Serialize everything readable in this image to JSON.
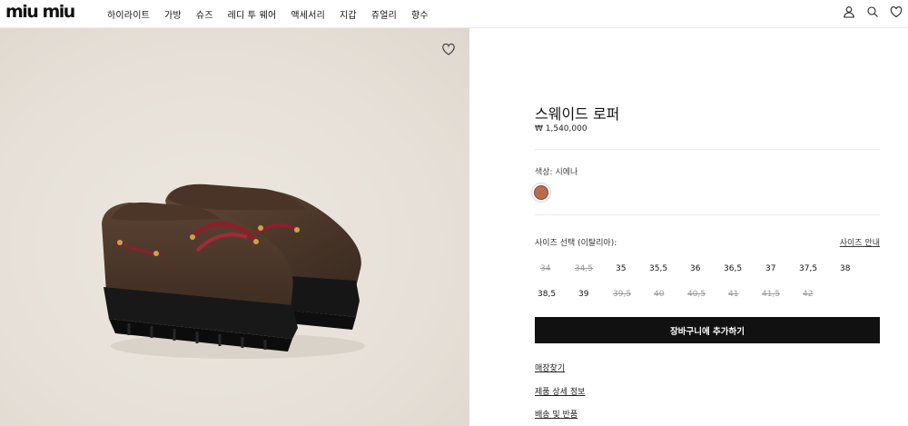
{
  "brand": {
    "logo_text": "miu miu"
  },
  "nav": {
    "items": [
      "하이라이트",
      "가방",
      "슈즈",
      "레디 투 웨어",
      "액세서리",
      "지갑",
      "쥬얼리",
      "향수"
    ]
  },
  "header_icons": [
    "user-icon",
    "search-icon",
    "heart-icon"
  ],
  "product": {
    "title": "스웨이드 로퍼",
    "price": "₩ 1,540,000",
    "color_label": "색상:  시에나",
    "color_swatch": "#bd6a4c",
    "size_label": "사이즈 선택 (이탈리아):",
    "size_guide": "사이즈 안내",
    "sizes": [
      {
        "label": "34",
        "available": false
      },
      {
        "label": "34,5",
        "available": false
      },
      {
        "label": "35",
        "available": true
      },
      {
        "label": "35,5",
        "available": true
      },
      {
        "label": "36",
        "available": true
      },
      {
        "label": "36,5",
        "available": true
      },
      {
        "label": "37",
        "available": true
      },
      {
        "label": "37,5",
        "available": true
      },
      {
        "label": "38",
        "available": true
      },
      {
        "label": "38,5",
        "available": true
      },
      {
        "label": "39",
        "available": true
      },
      {
        "label": "39,5",
        "available": false
      },
      {
        "label": "40",
        "available": false
      },
      {
        "label": "40,5",
        "available": false
      },
      {
        "label": "41",
        "available": false
      },
      {
        "label": "41,5",
        "available": false
      },
      {
        "label": "42",
        "available": false
      }
    ],
    "add_to_cart": "장바구니에 추가하기"
  },
  "links": {
    "store_finder": "매장찾기",
    "product_details": "제품 상세 정보",
    "shipping_returns": "배송 및 반품"
  },
  "colors": {
    "accent": "#111111",
    "background_image": "#e6e0d8"
  }
}
